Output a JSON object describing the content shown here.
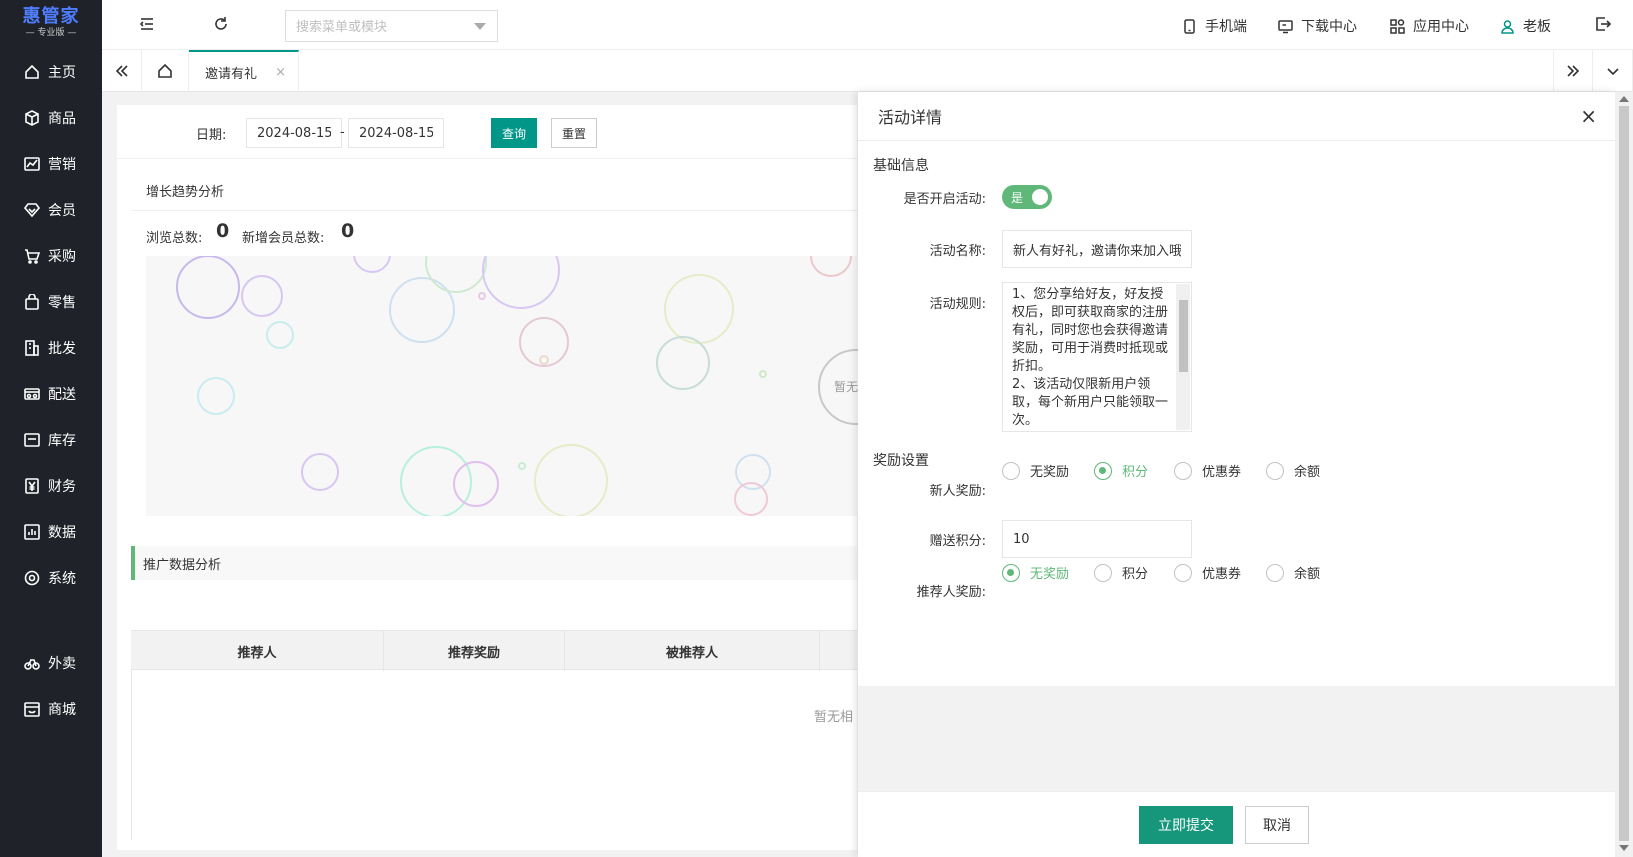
{
  "brand": {
    "name": "惠管家",
    "edition": "— 专业版 —"
  },
  "sidebar": {
    "items": [
      {
        "label": "主页",
        "icon": "home-icon"
      },
      {
        "label": "商品",
        "icon": "box-icon"
      },
      {
        "label": "营销",
        "icon": "trend-icon"
      },
      {
        "label": "会员",
        "icon": "diamond-icon"
      },
      {
        "label": "采购",
        "icon": "cart-icon"
      },
      {
        "label": "零售",
        "icon": "bag-icon"
      },
      {
        "label": "批发",
        "icon": "building-icon"
      },
      {
        "label": "配送",
        "icon": "truck-icon"
      },
      {
        "label": "库存",
        "icon": "inventory-icon"
      },
      {
        "label": "财务",
        "icon": "yen-icon"
      },
      {
        "label": "数据",
        "icon": "chart-icon"
      },
      {
        "label": "系统",
        "icon": "settings-icon"
      },
      {
        "label": "外卖",
        "icon": "bike-icon"
      },
      {
        "label": "商城",
        "icon": "store-icon"
      }
    ]
  },
  "topbar": {
    "search_placeholder": "搜索菜单或模块",
    "links": {
      "mobile": "手机端",
      "download": "下载中心",
      "apps": "应用中心",
      "user": "老板"
    }
  },
  "tabs": {
    "current": "邀请有礼",
    "close": "×"
  },
  "filter": {
    "date_label": "日期:",
    "start": "2024-08-15",
    "sep": "-",
    "end": "2024-08-15",
    "query": "查询",
    "reset": "重置"
  },
  "growth": {
    "title": "增长趋势分析",
    "views_label": "浏览总数:",
    "views_value": "0",
    "members_label": "新增会员总数:",
    "members_value": "0",
    "empty_partial": "暂无"
  },
  "promo": {
    "title": "推广数据分析",
    "columns": [
      "推荐人",
      "推荐奖励",
      "被推荐人"
    ],
    "empty_partial": "暂无相"
  },
  "panel": {
    "title": "活动详情",
    "close": "×",
    "basic_title": "基础信息",
    "enable_label": "是否开启活动:",
    "enable_value": "是",
    "name_label": "活动名称:",
    "name_value": "新人有好礼，邀请你来加入哦",
    "rules_label": "活动规则:",
    "rules_value": "1、您分享给好友，好友授权后，即可获取商家的注册有礼，同时您也会获得邀请奖励，可用于消费时抵现或折扣。\n2、该活动仅限新用户领取，每个新用户只能领取一次。",
    "reward_title": "奖励设置",
    "new_reward_label": "新人奖励:",
    "new_reward_options": [
      "无奖励",
      "积分",
      "优惠券",
      "余额"
    ],
    "new_reward_selected": "积分",
    "points_label": "赠送积分:",
    "points_value": "10",
    "ref_reward_label": "推荐人奖励:",
    "ref_reward_options": [
      "无奖励",
      "积分",
      "优惠券",
      "余额"
    ],
    "ref_reward_selected": "无奖励",
    "submit": "立即提交",
    "cancel": "取消"
  },
  "colors": {
    "primary": "#009688",
    "accent_green": "#5fb878",
    "sidebar_bg": "#1f2329",
    "submit": "#16977b"
  }
}
